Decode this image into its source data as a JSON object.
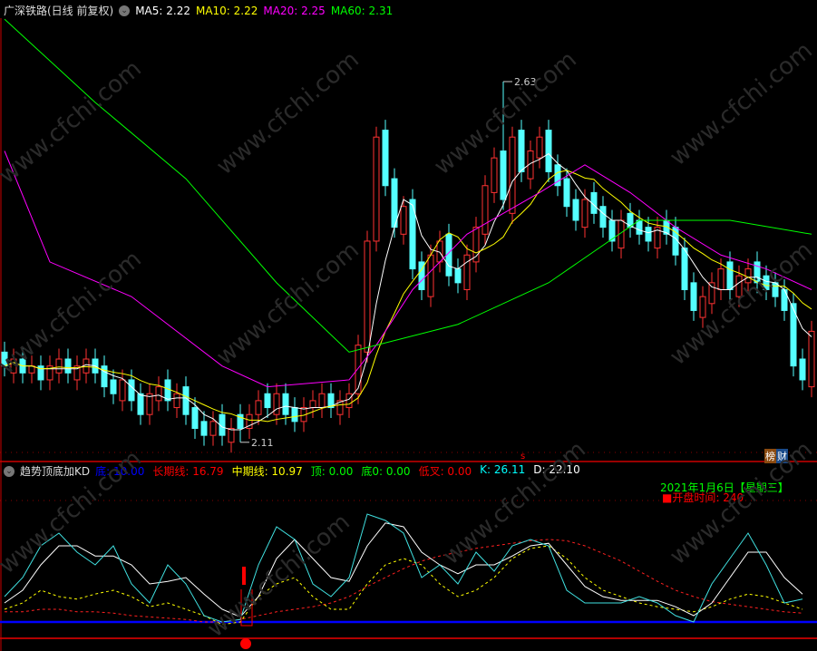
{
  "title": "广深铁路(日线 前复权)",
  "ma_legend": [
    {
      "label": "MA5: 2.22",
      "color": "#ffffff"
    },
    {
      "label": "MA10: 2.22",
      "color": "#ffff00"
    },
    {
      "label": "MA20: 2.25",
      "color": "#ff00ff"
    },
    {
      "label": "MA60: 2.31",
      "color": "#00ff00"
    }
  ],
  "indicator": {
    "name": "趋势顶底加KD",
    "items": [
      {
        "label": "底: 10.00",
        "color": "#0000ff"
      },
      {
        "label": "长期线: 16.79",
        "color": "#ff0000"
      },
      {
        "label": "中期线: 10.97",
        "color": "#ffff00"
      },
      {
        "label": "顶: 0.00",
        "color": "#00ff00"
      },
      {
        "label": "底0: 0.00",
        "color": "#00ff00"
      },
      {
        "label": "低叉: 0.00",
        "color": "#ff0000"
      },
      {
        "label": "K: 26.11",
        "color": "#00ffff"
      },
      {
        "label": "D: 22.10",
        "color": "#ffffff"
      }
    ]
  },
  "badge": {
    "a": "榜",
    "b": "财"
  },
  "date_text": "2021年1月6日【星期三】",
  "open_time": "■开盘时间:  240",
  "watermark": "www.cfchi.com",
  "chart_data": {
    "type": "candlestick",
    "high_label": "2.63",
    "low_label": "2.11",
    "high": 2.63,
    "high_index": 55,
    "low": 2.11,
    "low_index": 26,
    "ylim": [
      2.08,
      2.75
    ],
    "close": [
      2.22,
      2.23,
      2.21,
      2.22,
      2.2,
      2.22,
      2.23,
      2.21,
      2.22,
      2.23,
      2.21,
      2.19,
      2.18,
      2.2,
      2.17,
      2.15,
      2.18,
      2.19,
      2.17,
      2.18,
      2.15,
      2.13,
      2.12,
      2.14,
      2.12,
      2.13,
      2.13,
      2.15,
      2.17,
      2.16,
      2.18,
      2.15,
      2.14,
      2.16,
      2.17,
      2.18,
      2.16,
      2.17,
      2.18,
      2.25,
      2.4,
      2.55,
      2.48,
      2.42,
      2.45,
      2.36,
      2.33,
      2.38,
      2.4,
      2.35,
      2.34,
      2.38,
      2.42,
      2.48,
      2.52,
      2.46,
      2.55,
      2.5,
      2.53,
      2.55,
      2.5,
      2.48,
      2.45,
      2.43,
      2.46,
      2.44,
      2.42,
      2.4,
      2.43,
      2.42,
      2.41,
      2.4,
      2.42,
      2.41,
      2.38,
      2.33,
      2.3,
      2.32,
      2.34,
      2.36,
      2.33,
      2.35,
      2.36,
      2.34,
      2.33,
      2.32,
      2.3,
      2.22,
      2.2,
      2.27
    ],
    "open": [
      2.24,
      2.21,
      2.23,
      2.21,
      2.22,
      2.2,
      2.21,
      2.23,
      2.2,
      2.21,
      2.23,
      2.22,
      2.2,
      2.17,
      2.2,
      2.18,
      2.15,
      2.17,
      2.2,
      2.16,
      2.19,
      2.16,
      2.14,
      2.12,
      2.15,
      2.11,
      2.15,
      2.13,
      2.15,
      2.18,
      2.15,
      2.18,
      2.16,
      2.14,
      2.16,
      2.16,
      2.18,
      2.15,
      2.16,
      2.18,
      2.24,
      2.4,
      2.56,
      2.49,
      2.41,
      2.46,
      2.37,
      2.32,
      2.37,
      2.41,
      2.36,
      2.33,
      2.37,
      2.41,
      2.47,
      2.53,
      2.44,
      2.56,
      2.49,
      2.52,
      2.56,
      2.51,
      2.49,
      2.46,
      2.42,
      2.47,
      2.45,
      2.43,
      2.39,
      2.44,
      2.43,
      2.42,
      2.39,
      2.43,
      2.42,
      2.39,
      2.34,
      2.29,
      2.31,
      2.33,
      2.37,
      2.32,
      2.34,
      2.37,
      2.35,
      2.34,
      2.33,
      2.31,
      2.23,
      2.19
    ],
    "ma20": [
      [
        0,
        2.53
      ],
      [
        5,
        2.37
      ],
      [
        14,
        2.32
      ],
      [
        24,
        2.22
      ],
      [
        29,
        2.19
      ],
      [
        38,
        2.2
      ],
      [
        41,
        2.25
      ],
      [
        45,
        2.33
      ],
      [
        51,
        2.41
      ],
      [
        59,
        2.47
      ],
      [
        64,
        2.51
      ],
      [
        69,
        2.47
      ],
      [
        74,
        2.42
      ],
      [
        79,
        2.38
      ],
      [
        84,
        2.36
      ],
      [
        89,
        2.33
      ]
    ],
    "ma60": [
      [
        0,
        2.72
      ],
      [
        10,
        2.6
      ],
      [
        20,
        2.49
      ],
      [
        30,
        2.34
      ],
      [
        38,
        2.24
      ],
      [
        50,
        2.28
      ],
      [
        60,
        2.34
      ],
      [
        70,
        2.43
      ],
      [
        80,
        2.43
      ],
      [
        89,
        2.41
      ]
    ],
    "kd": {
      "ylim": [
        0,
        105
      ],
      "bottom_line": 10,
      "K": [
        30,
        45,
        70,
        80,
        65,
        55,
        70,
        40,
        25,
        55,
        40,
        15,
        10,
        12,
        55,
        85,
        75,
        40,
        30,
        45,
        95,
        90,
        80,
        45,
        55,
        40,
        65,
        50,
        70,
        75,
        70,
        35,
        25,
        25,
        25,
        30,
        25,
        15,
        10,
        40,
        60,
        80,
        55,
        25,
        28
      ],
      "D": [
        25,
        35,
        55,
        70,
        70,
        62,
        62,
        55,
        40,
        42,
        45,
        32,
        20,
        14,
        30,
        60,
        75,
        60,
        45,
        42,
        70,
        88,
        85,
        65,
        55,
        48,
        55,
        55,
        62,
        70,
        72,
        55,
        38,
        30,
        27,
        27,
        27,
        22,
        15,
        25,
        45,
        65,
        65,
        45,
        32
      ],
      "mid": [
        20,
        25,
        35,
        30,
        28,
        32,
        35,
        30,
        22,
        25,
        20,
        15,
        8,
        10,
        30,
        40,
        45,
        30,
        20,
        20,
        40,
        55,
        60,
        55,
        40,
        30,
        35,
        45,
        60,
        68,
        70,
        60,
        45,
        35,
        30,
        25,
        22,
        20,
        18,
        22,
        28,
        32,
        30,
        25,
        20
      ],
      "long": [
        18,
        18,
        20,
        20,
        18,
        18,
        17,
        15,
        14,
        13,
        12,
        10,
        10,
        12,
        15,
        18,
        20,
        22,
        25,
        30,
        38,
        45,
        52,
        58,
        62,
        65,
        68,
        70,
        72,
        74,
        75,
        74,
        70,
        64,
        58,
        50,
        42,
        35,
        30,
        26,
        24,
        22,
        20,
        18,
        17
      ]
    }
  }
}
